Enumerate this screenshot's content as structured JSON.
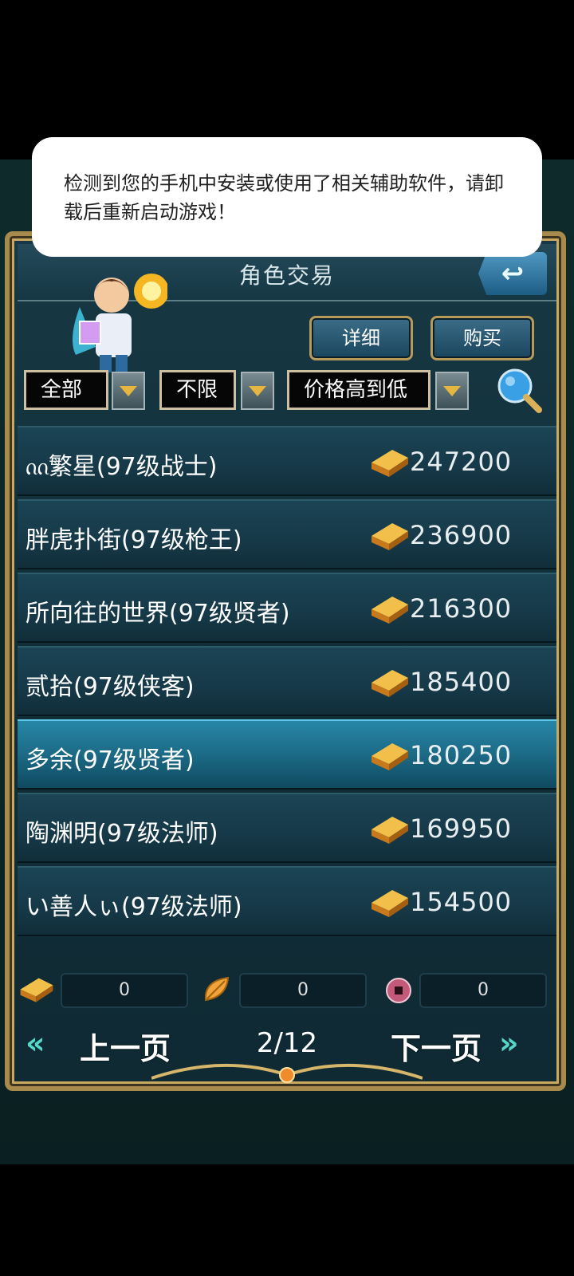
{
  "alert": {
    "message": "检测到您的手机中安装或使用了相关辅助软件，请卸载后重新启动游戏！"
  },
  "header": {
    "title": "角色交易"
  },
  "actions": {
    "detail_label": "详细",
    "buy_label": "购买"
  },
  "filters": {
    "class_filter": "全部",
    "level_filter": "不限",
    "sort_order": "价格高到低"
  },
  "listings": [
    {
      "name": "ᦶ繁星(97级战士)",
      "price": "247200"
    },
    {
      "name": "胖虎扑街(97级枪王)",
      "price": "236900"
    },
    {
      "name": "所向往的世界(97级贤者)",
      "price": "216300"
    },
    {
      "name": "贰拾(97级侠客)",
      "price": "185400"
    },
    {
      "name": "多余(97级贤者)",
      "price": "180250",
      "selected": true
    },
    {
      "name": "陶渊明(97级法师)",
      "price": "169950"
    },
    {
      "name": "い善人ぃ(97级法师)",
      "price": "154500"
    }
  ],
  "currencies": {
    "gold": "0",
    "leaf": "0",
    "coin": "0"
  },
  "pager": {
    "prev_label": "上一页",
    "next_label": "下一页",
    "page_indicator": "2/12"
  },
  "colors": {
    "accent_gold": "#e7a83a",
    "frame": "#a88a4d",
    "selected_row": "#2786a6"
  }
}
